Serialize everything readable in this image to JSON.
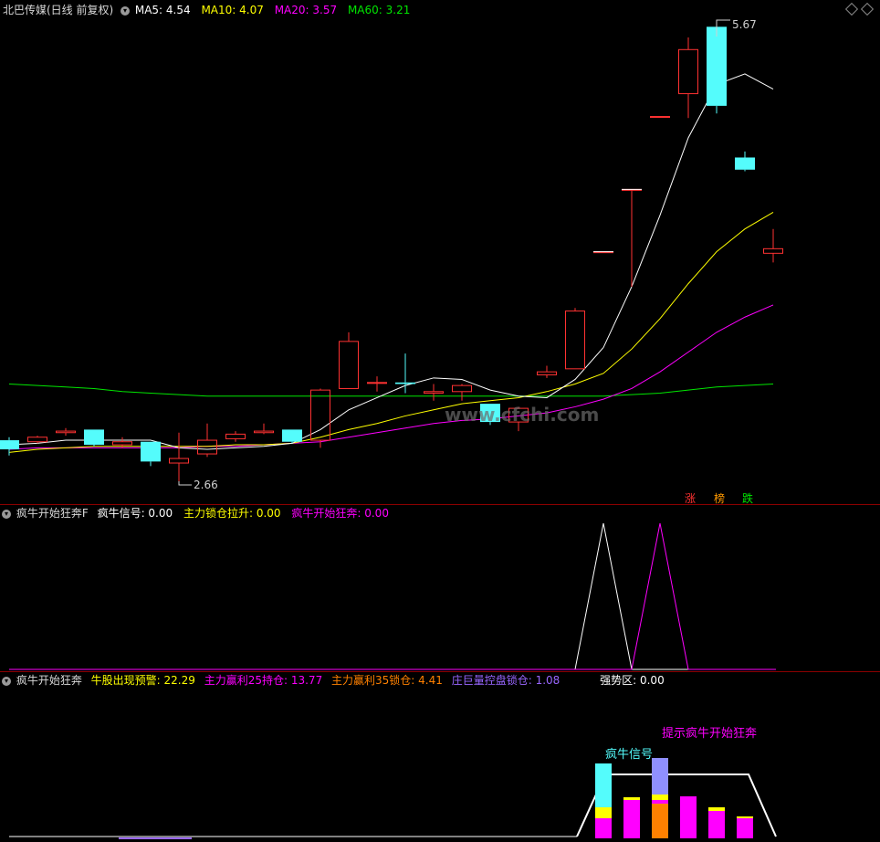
{
  "panel1": {
    "title": "北巴传媒(日线 前复权)",
    "ma5": "MA5: 4.54",
    "ma10": "MA10: 4.07",
    "ma20": "MA20: 3.57",
    "ma60": "MA60: 3.21",
    "high_label": "5.67",
    "low_label": "2.66",
    "watermark": "www.cfchi.com",
    "tags": [
      "涨",
      "榜",
      "跌"
    ]
  },
  "panel2": {
    "title": "疯牛开始狂奔F",
    "s1": "疯牛信号: 0.00",
    "s2": "主力锁仓拉升: 0.00",
    "s3": "疯牛开始狂奔: 0.00"
  },
  "panel3": {
    "title": "疯牛开始狂奔",
    "s1": "牛股出现预警: 22.29",
    "s2": "主力赢利25持仓: 13.77",
    "s3": "主力赢利35锁仓: 4.41",
    "s4": "庄巨量控盘锁仓: 1.08",
    "s5": "强势区: 0.00",
    "label_signal": "疯牛信号",
    "label_hint": "提示疯牛开始狂奔"
  },
  "colors": {
    "up": "#ff3232",
    "down": "#54fcfc",
    "ma5": "#ffffff",
    "ma10": "#ffff00",
    "ma20": "#ff00ff",
    "ma60": "#00e600",
    "magenta": "#ff00ff",
    "orange": "#ff8000",
    "purple": "#9966ff"
  },
  "icons": [
    "dropdown-circle-icon",
    "diamond-icon",
    "arrow-left-icon"
  ],
  "candles": [
    {
      "o": 2.93,
      "h": 2.95,
      "l": 2.83,
      "c": 2.87
    },
    {
      "o": 2.92,
      "h": 2.96,
      "l": 2.91,
      "c": 2.95
    },
    {
      "o": 2.98,
      "h": 3.01,
      "l": 2.96,
      "c": 2.99
    },
    {
      "o": 3.0,
      "h": 3.0,
      "l": 2.89,
      "c": 2.9
    },
    {
      "o": 2.9,
      "h": 2.95,
      "l": 2.88,
      "c": 2.92
    },
    {
      "o": 2.92,
      "h": 2.92,
      "l": 2.76,
      "c": 2.79
    },
    {
      "o": 2.78,
      "h": 2.98,
      "l": 2.66,
      "c": 2.81
    },
    {
      "o": 2.84,
      "h": 3.04,
      "l": 2.82,
      "c": 2.93
    },
    {
      "o": 2.94,
      "h": 2.99,
      "l": 2.92,
      "c": 2.97
    },
    {
      "o": 2.98,
      "h": 3.04,
      "l": 2.97,
      "c": 2.99
    },
    {
      "o": 3.0,
      "h": 3.0,
      "l": 2.91,
      "c": 2.92
    },
    {
      "o": 2.93,
      "h": 3.27,
      "l": 2.88,
      "c": 3.26
    },
    {
      "o": 3.27,
      "h": 3.64,
      "l": 3.27,
      "c": 3.58
    },
    {
      "o": 3.31,
      "h": 3.35,
      "l": 3.25,
      "c": 3.31
    },
    {
      "o": 3.31,
      "h": 3.5,
      "l": 3.24,
      "c": 3.3
    },
    {
      "o": 3.24,
      "h": 3.3,
      "l": 3.19,
      "c": 3.25
    },
    {
      "o": 3.25,
      "h": 3.3,
      "l": 3.19,
      "c": 3.29
    },
    {
      "o": 3.17,
      "h": 3.17,
      "l": 3.03,
      "c": 3.05
    },
    {
      "o": 3.05,
      "h": 3.15,
      "l": 2.99,
      "c": 3.14
    },
    {
      "o": 3.36,
      "h": 3.42,
      "l": 3.34,
      "c": 3.38
    },
    {
      "o": 3.4,
      "h": 3.8,
      "l": 3.4,
      "c": 3.78
    },
    {
      "o": 4.17,
      "h": 4.17,
      "l": 4.17,
      "c": 4.17
    },
    {
      "o": 4.58,
      "h": 4.58,
      "l": 3.94,
      "c": 4.58
    },
    {
      "o": 5.06,
      "h": 5.06,
      "l": 5.06,
      "c": 5.06
    },
    {
      "o": 5.21,
      "h": 5.58,
      "l": 5.05,
      "c": 5.5
    },
    {
      "o": 5.65,
      "h": 5.67,
      "l": 5.08,
      "c": 5.13
    },
    {
      "o": 4.79,
      "h": 4.83,
      "l": 4.7,
      "c": 4.71
    },
    {
      "o": 4.16,
      "h": 4.32,
      "l": 4.1,
      "c": 4.19
    }
  ],
  "ma5_line": [
    2.9,
    2.91,
    2.93,
    2.93,
    2.93,
    2.93,
    2.88,
    2.87,
    2.88,
    2.89,
    2.91,
    3.0,
    3.13,
    3.21,
    3.29,
    3.34,
    3.33,
    3.26,
    3.22,
    3.21,
    3.33,
    3.54,
    3.94,
    4.41,
    4.92,
    5.27,
    5.34,
    5.24
  ],
  "ma10_line": [
    2.85,
    2.87,
    2.88,
    2.89,
    2.89,
    2.89,
    2.89,
    2.89,
    2.9,
    2.9,
    2.91,
    2.95,
    3.0,
    3.04,
    3.09,
    3.13,
    3.17,
    3.19,
    3.21,
    3.25,
    3.3,
    3.37,
    3.53,
    3.73,
    3.96,
    4.17,
    4.32,
    4.43
  ],
  "ma20_line": [
    2.87,
    2.88,
    2.88,
    2.88,
    2.88,
    2.88,
    2.88,
    2.89,
    2.89,
    2.9,
    2.91,
    2.92,
    2.95,
    2.98,
    3.01,
    3.04,
    3.06,
    3.07,
    3.09,
    3.11,
    3.15,
    3.2,
    3.27,
    3.38,
    3.51,
    3.64,
    3.74,
    3.82
  ],
  "ma60_line": [
    3.3,
    3.29,
    3.28,
    3.27,
    3.25,
    3.24,
    3.23,
    3.22,
    3.22,
    3.22,
    3.22,
    3.22,
    3.22,
    3.22,
    3.22,
    3.22,
    3.22,
    3.22,
    3.22,
    3.22,
    3.22,
    3.22,
    3.23,
    3.24,
    3.26,
    3.28,
    3.29,
    3.3
  ],
  "panel2_white": [
    0,
    0,
    0,
    0,
    0,
    0,
    0,
    0,
    0,
    0,
    0,
    0,
    0,
    0,
    0,
    0,
    0,
    0,
    0,
    0,
    0,
    1,
    0,
    0,
    0,
    0,
    0,
    0
  ],
  "panel2_magenta": [
    0,
    0,
    0,
    0,
    0,
    0,
    0,
    0,
    0,
    0,
    0,
    0,
    0,
    0,
    0,
    0,
    0,
    0,
    0,
    0,
    0,
    0,
    0,
    1,
    0,
    0,
    0,
    0
  ],
  "panel3_bars": [
    {
      "i": 21,
      "cyan": 48,
      "yellow": 12,
      "magenta": 22
    },
    {
      "i": 22,
      "magenta": 42,
      "yellow": 3
    },
    {
      "i": 23,
      "purple": 40,
      "yellow": 6,
      "magenta": 4,
      "orange": 38
    },
    {
      "i": 24,
      "magenta": 46
    },
    {
      "i": 25,
      "magenta": 30,
      "yellow": 4
    },
    {
      "i": 26,
      "magenta": 22,
      "yellow": 2
    }
  ]
}
